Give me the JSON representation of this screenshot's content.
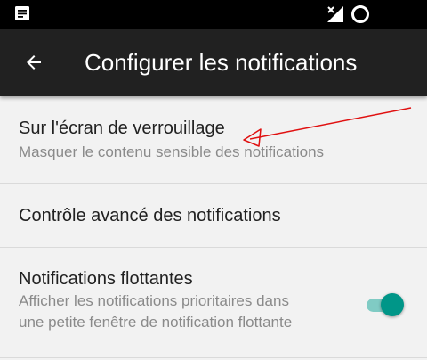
{
  "status_bar": {
    "left_icon": "notification-icon",
    "signal_icon": "no-signal-icon",
    "battery_icon": "battery-ring-icon"
  },
  "app_bar": {
    "back_icon": "arrow-back-icon",
    "title": "Configurer les notifications"
  },
  "settings": {
    "items": [
      {
        "title": "Sur l'écran de verrouillage",
        "summary": "Masquer le contenu sensible des notifications"
      },
      {
        "title": "Contrôle avancé des notifications"
      },
      {
        "title": "Notifications flottantes",
        "summary_line1": "Afficher les notifications prioritaires dans",
        "summary_line2": "une petite fenêtre de notification flottante",
        "toggle_on": true
      }
    ]
  },
  "colors": {
    "status_bar": "#000000",
    "app_bar": "#212121",
    "background": "#f2f2f2",
    "accent": "#009688",
    "accent_track": "#80cbc4",
    "annotation_arrow": "#e01010"
  }
}
